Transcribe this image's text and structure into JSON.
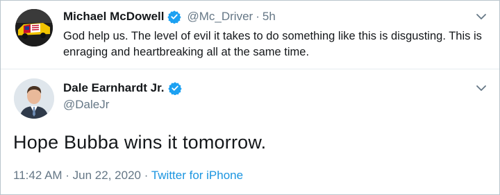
{
  "tweets": [
    {
      "author_name": "Michael McDowell",
      "handle": "@Mc_Driver",
      "separator": "·",
      "time": "5h",
      "text": "God help us. The level of evil it takes to do something like this is disgusting. This is enraging and heartbreaking all at the same time.",
      "avatar_icon": "race-car-avatar",
      "verified_icon": "verified-badge-icon",
      "menu_icon": "chevron-down-icon"
    },
    {
      "author_name": "Dale Earnhardt Jr.",
      "handle": "@DaleJr",
      "text": "Hope Bubba wins it tomorrow.",
      "timestamp": "11:42 AM · Jun 22, 2020",
      "separator": "·",
      "source": "Twitter for iPhone",
      "avatar_icon": "person-avatar",
      "verified_icon": "verified-badge-icon",
      "menu_icon": "chevron-down-icon"
    }
  ],
  "colors": {
    "text": "#14171a",
    "secondary": "#657786",
    "link": "#1b95e0",
    "verified": "#1da1f2",
    "border": "#e6ecf0"
  }
}
